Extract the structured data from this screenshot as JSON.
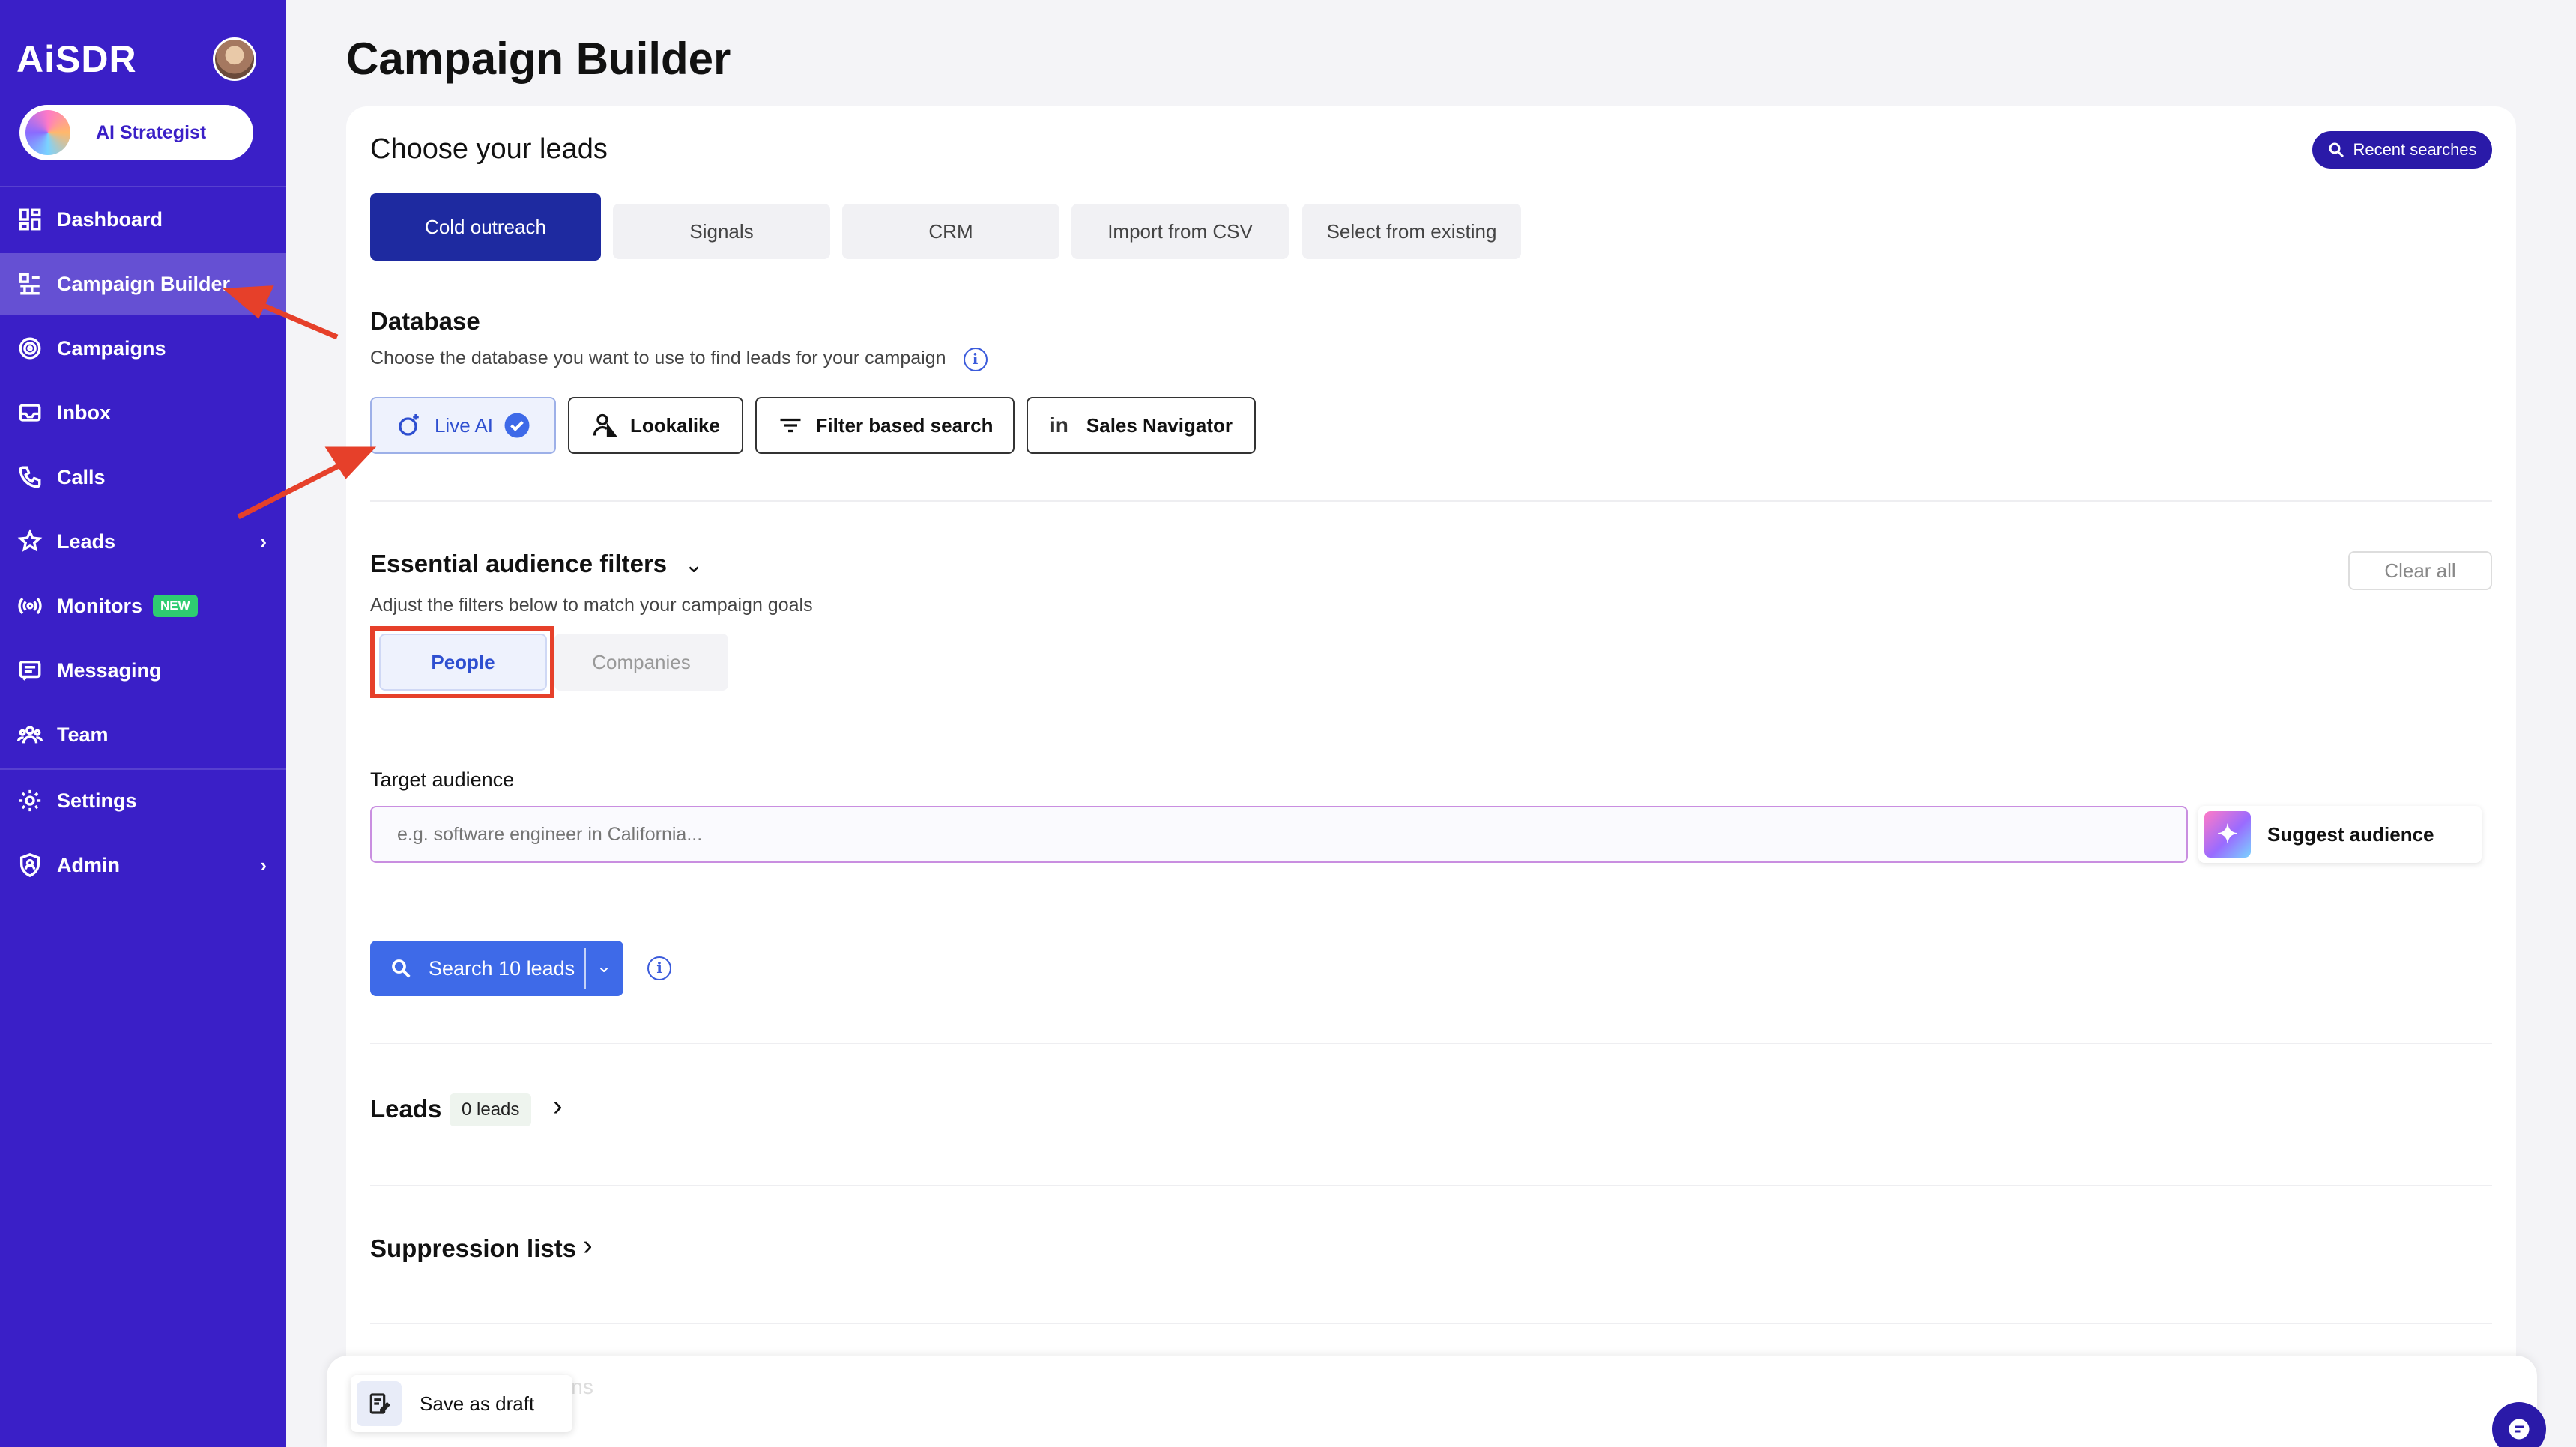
{
  "sidebar": {
    "logo": "AiSDR",
    "strategist_label": "AI Strategist",
    "items": [
      {
        "label": "Dashboard"
      },
      {
        "label": "Campaign Builder"
      },
      {
        "label": "Campaigns"
      },
      {
        "label": "Inbox"
      },
      {
        "label": "Calls"
      },
      {
        "label": "Leads"
      },
      {
        "label": "Monitors",
        "badge": "NEW"
      },
      {
        "label": "Messaging"
      },
      {
        "label": "Team"
      },
      {
        "label": "Settings"
      },
      {
        "label": "Admin"
      }
    ]
  },
  "page": {
    "title": "Campaign Builder"
  },
  "leads_section": {
    "title": "Choose your leads",
    "recent_searches": "Recent searches",
    "tabs": [
      {
        "label": "Cold outreach",
        "active": true
      },
      {
        "label": "Signals"
      },
      {
        "label": "CRM"
      },
      {
        "label": "Import from CSV"
      },
      {
        "label": "Select from existing"
      }
    ]
  },
  "database": {
    "title": "Database",
    "subtitle": "Choose the database you want to use to find leads for your campaign",
    "options": [
      {
        "label": "Live AI",
        "selected": true
      },
      {
        "label": "Lookalike"
      },
      {
        "label": "Filter based search"
      },
      {
        "label": "Sales Navigator"
      }
    ]
  },
  "filters": {
    "title": "Essential audience filters",
    "subtitle": "Adjust the filters below to match your campaign goals",
    "clear_all": "Clear all",
    "segments": [
      "People",
      "Companies"
    ],
    "target_label": "Target audience",
    "target_placeholder": "e.g. software engineer in California...",
    "suggest_label": "Suggest audience",
    "search_button": "Search 10 leads"
  },
  "leads": {
    "title": "Leads",
    "count": "0 leads"
  },
  "suppression": {
    "title": "Suppression lists"
  },
  "footer": {
    "save_draft": "Save as draft",
    "hidden_label": "Actions"
  },
  "colors": {
    "sidebar": "#3a1fc7",
    "primary": "#1e2aa0",
    "accent": "#3e6ae8",
    "annotation": "#e6402a"
  }
}
